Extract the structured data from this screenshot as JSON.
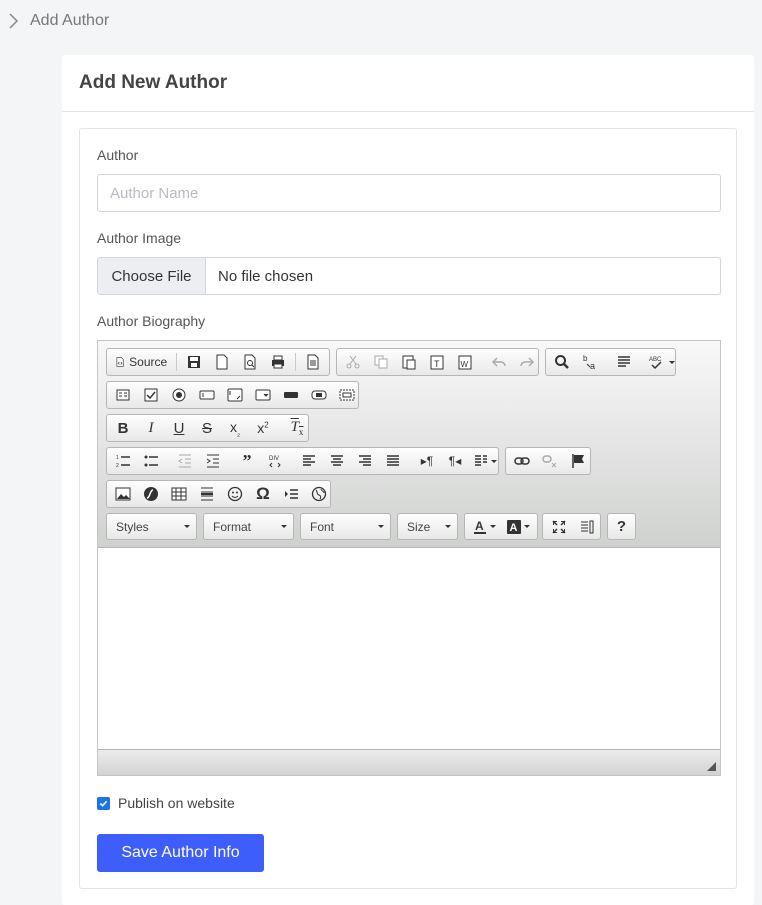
{
  "breadcrumb": {
    "label": "Add Author"
  },
  "card": {
    "title": "Add New Author"
  },
  "form": {
    "author_label": "Author",
    "author_placeholder": "Author Name",
    "author_value": "",
    "image_label": "Author Image",
    "choose_file_label": "Choose File",
    "file_status": "No file chosen",
    "bio_label": "Author Biography",
    "publish_label": "Publish on website",
    "publish_checked": true,
    "save_label": "Save Author Info"
  },
  "editor": {
    "source_label": "Source",
    "combos": {
      "styles": "Styles",
      "format": "Format",
      "font": "Font",
      "size": "Size"
    },
    "help_label": "?",
    "buttons": {
      "source": "source-icon",
      "save": "save-icon",
      "new_page": "new-page-icon",
      "preview": "preview-icon",
      "print": "print-icon",
      "templates": "templates-icon",
      "cut": "cut-icon",
      "copy": "copy-icon",
      "paste": "paste-icon",
      "paste_text": "paste-text-icon",
      "paste_word": "paste-word-icon",
      "undo": "undo-icon",
      "redo": "redo-icon",
      "find": "find-icon",
      "replace": "replace-icon",
      "select_all": "select-all-icon",
      "spellcheck": "spellcheck-icon",
      "form": "form-icon",
      "checkbox": "checkbox-icon",
      "radio": "radio-icon",
      "textfield": "textfield-icon",
      "textarea": "textarea-icon",
      "select": "select-icon",
      "button": "button-icon",
      "image_button": "image-button-icon",
      "hidden_field": "hidden-field-icon",
      "bold": "bold-icon",
      "italic": "italic-icon",
      "underline": "underline-icon",
      "strike": "strikethrough-icon",
      "subscript": "subscript-icon",
      "superscript": "superscript-icon",
      "remove_format": "remove-format-icon",
      "ordered_list": "numbered-list-icon",
      "bullet_list": "bulleted-list-icon",
      "outdent": "outdent-icon",
      "indent": "indent-icon",
      "blockquote": "blockquote-icon",
      "div": "div-container-icon",
      "align_left": "align-left-icon",
      "align_center": "align-center-icon",
      "align_right": "align-right-icon",
      "justify": "justify-icon",
      "ltr": "text-direction-ltr-icon",
      "rtl": "text-direction-rtl-icon",
      "language": "language-icon",
      "link": "link-icon",
      "unlink": "unlink-icon",
      "anchor": "anchor-flag-icon",
      "image": "image-icon",
      "flash": "flash-icon",
      "table": "table-icon",
      "hr": "horizontal-line-icon",
      "smiley": "smiley-icon",
      "special_char": "special-character-icon",
      "page_break": "page-break-icon",
      "iframe": "iframe-globe-icon",
      "text_color": "text-color-icon",
      "bg_color": "background-color-icon",
      "maximize": "maximize-icon",
      "show_blocks": "show-blocks-icon",
      "about": "about-icon"
    }
  },
  "colors": {
    "accent": "#3d5efb",
    "checkbox": "#1a73e8",
    "background": "#f4f5f7"
  }
}
